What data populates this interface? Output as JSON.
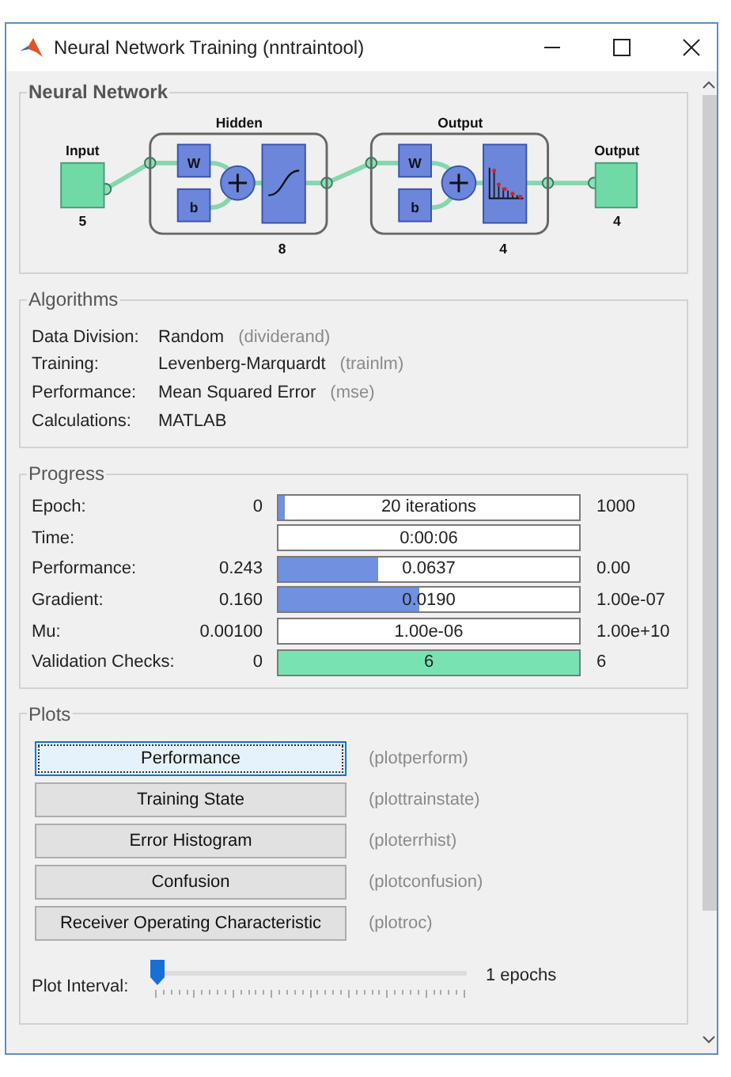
{
  "window": {
    "title": "Neural Network Training (nntraintool)"
  },
  "neural_network": {
    "title": "Neural Network",
    "input": {
      "label": "Input",
      "size": "5"
    },
    "layers": [
      {
        "title": "Hidden",
        "weight": "W",
        "bias": "b",
        "size": "8",
        "kind": "sigmoid"
      },
      {
        "title": "Output",
        "weight": "W",
        "bias": "b",
        "size": "4",
        "kind": "softmax"
      }
    ],
    "output": {
      "label": "Output",
      "size": "4"
    }
  },
  "algorithms": {
    "title": "Algorithms",
    "rows": [
      {
        "label": "Data Division:",
        "value": "Random",
        "function": "(dividerand)"
      },
      {
        "label": "Training:",
        "value": "Levenberg-Marquardt",
        "function": "(trainlm)"
      },
      {
        "label": "Performance:",
        "value": "Mean Squared Error",
        "function": "(mse)"
      },
      {
        "label": "Calculations:",
        "value": "MATLAB"
      }
    ]
  },
  "progress": {
    "title": "Progress",
    "rows": [
      {
        "label": "Epoch:",
        "start": "0",
        "bar_text": "20 iterations",
        "level": 0.02,
        "end": "1000",
        "color": "#7090e0"
      },
      {
        "label": "Time:",
        "bar_text": "0:00:06"
      },
      {
        "label": "Performance:",
        "start": "0.243",
        "bar_text": "0.0637",
        "level": 0.33,
        "end": "0.00",
        "color": "#7090e0"
      },
      {
        "label": "Gradient:",
        "start": "0.160",
        "bar_text": "0.0190",
        "level": 0.47,
        "end": "1.00e-07",
        "color": "#7090e0"
      },
      {
        "label": "Mu:",
        "start": "0.00100",
        "bar_text": "1.00e-06",
        "end": "1.00e+10"
      },
      {
        "label": "Validation Checks:",
        "start": "0",
        "bar_text": "6",
        "level": 1,
        "end": "6",
        "color": "#78e3b2"
      }
    ]
  },
  "plots": {
    "title": "Plots",
    "buttons": [
      {
        "label": "Performance",
        "function": "(plotperform)",
        "focused": true
      },
      {
        "label": "Training State",
        "function": "(plottrainstate)",
        "focused": false
      },
      {
        "label": "Error Histogram",
        "function": "(ploterrhist)",
        "focused": false
      },
      {
        "label": "Confusion",
        "function": "(plotconfusion)",
        "focused": false
      },
      {
        "label": "Receiver Operating Characteristic",
        "function": "(plotroc)",
        "focused": false
      }
    ],
    "interval": {
      "label": "Plot Interval:",
      "level": 0,
      "reading": "1 epochs"
    }
  }
}
